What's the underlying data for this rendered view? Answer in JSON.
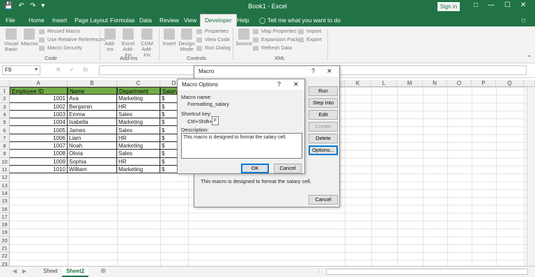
{
  "window": {
    "title": "Book1 - Excel",
    "sign_in": "Sign in"
  },
  "tabs": [
    "File",
    "Home",
    "Insert",
    "Page Layout",
    "Formulas",
    "Data",
    "Review",
    "View",
    "Developer",
    "Help"
  ],
  "active_tab": "Developer",
  "tell_me": "Tell me what you want to do",
  "ribbon": {
    "code": {
      "visual_basic": "Visual Basic",
      "macros": "Macros",
      "record_macro": "Record Macro",
      "use_relative": "Use Relative References",
      "macro_security": "Macro Security",
      "group": "Code"
    },
    "addins": {
      "addins": "Add-ins",
      "excel_addins": "Excel Add-ins",
      "com_addins": "COM Add-ins",
      "group": "Add-ins"
    },
    "controls": {
      "insert": "Insert",
      "design_mode": "Design Mode",
      "properties": "Properties",
      "view_code": "View Code",
      "run_dialog": "Run Dialog",
      "group": "Controls"
    },
    "xml": {
      "source": "Source",
      "map_properties": "Map Properties",
      "expansion_packs": "Expansion Packs",
      "refresh_data": "Refresh Data",
      "import": "Import",
      "export": "Export",
      "group": "XML"
    }
  },
  "name_box": "F9",
  "columns": [
    "A",
    "B",
    "C",
    "D",
    "E",
    "F",
    "G",
    "H",
    "I",
    "J",
    "K",
    "L",
    "M",
    "N",
    "O",
    "P",
    "Q"
  ],
  "rows": [
    "1",
    "2",
    "3",
    "4",
    "5",
    "6",
    "7",
    "8",
    "9",
    "10",
    "11",
    "12",
    "13",
    "14",
    "15",
    "16",
    "17",
    "18",
    "19",
    "20",
    "21",
    "22",
    "23"
  ],
  "table": {
    "headers": [
      "Employee ID",
      "Name",
      "Department",
      "Salary"
    ],
    "rows": [
      [
        "1001",
        "Ava",
        "Marketing",
        "$"
      ],
      [
        "1002",
        "Benjamin",
        "HR",
        "$"
      ],
      [
        "1003",
        "Emma",
        "Sales",
        "$"
      ],
      [
        "1004",
        "Isabella",
        "Marketing",
        "$"
      ],
      [
        "1005",
        "James",
        "Sales",
        "$"
      ],
      [
        "1006",
        "Liam",
        "HR",
        "$"
      ],
      [
        "1007",
        "Noah",
        "Marketing",
        "$"
      ],
      [
        "1008",
        "Olivia",
        "Sales",
        "$"
      ],
      [
        "1009",
        "Sophia",
        "HR",
        "$"
      ],
      [
        "1010",
        "William",
        "Marketing",
        "$"
      ]
    ]
  },
  "sheets": [
    "Sheet",
    "Sheet2"
  ],
  "active_sheet": "Sheet2",
  "macro_dialog": {
    "title": "Macro",
    "run": "Run",
    "step_into": "Step Into",
    "edit": "Edit",
    "create": "Create",
    "delete": "Delete",
    "options": "Options...",
    "description_text": "This macro is designed to format the salary cell.",
    "cancel": "Cancel"
  },
  "macro_options": {
    "title": "Macro Options",
    "help": "?",
    "macro_name_label": "Macro name:",
    "macro_name": "Formatting_salary",
    "shortcut_label": "Shortcut key:",
    "shortcut_prefix": "Ctrl+Shift+",
    "shortcut_value": "F",
    "description_label": "Description:",
    "description": "This macro is designed to format the salary cell.",
    "ok": "OK",
    "cancel": "Cancel"
  }
}
